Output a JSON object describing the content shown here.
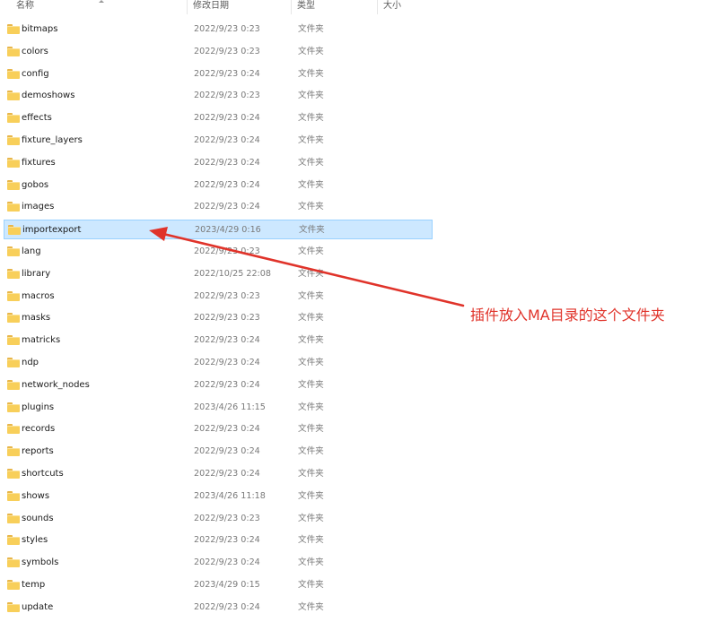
{
  "columns": {
    "name": "名称",
    "date": "修改日期",
    "type": "类型",
    "size": "大小"
  },
  "rows": [
    {
      "name": "bitmaps",
      "date": "2022/9/23 0:23",
      "type": "文件夹"
    },
    {
      "name": "colors",
      "date": "2022/9/23 0:23",
      "type": "文件夹"
    },
    {
      "name": "config",
      "date": "2022/9/23 0:24",
      "type": "文件夹"
    },
    {
      "name": "demoshows",
      "date": "2022/9/23 0:23",
      "type": "文件夹"
    },
    {
      "name": "effects",
      "date": "2022/9/23 0:24",
      "type": "文件夹"
    },
    {
      "name": "fixture_layers",
      "date": "2022/9/23 0:24",
      "type": "文件夹"
    },
    {
      "name": "fixtures",
      "date": "2022/9/23 0:24",
      "type": "文件夹"
    },
    {
      "name": "gobos",
      "date": "2022/9/23 0:24",
      "type": "文件夹"
    },
    {
      "name": "images",
      "date": "2022/9/23 0:24",
      "type": "文件夹"
    },
    {
      "name": "importexport",
      "date": "2023/4/29 0:16",
      "type": "文件夹",
      "selected": true
    },
    {
      "name": "lang",
      "date": "2022/9/23 0:23",
      "type": "文件夹"
    },
    {
      "name": "library",
      "date": "2022/10/25 22:08",
      "type": "文件夹"
    },
    {
      "name": "macros",
      "date": "2022/9/23 0:23",
      "type": "文件夹"
    },
    {
      "name": "masks",
      "date": "2022/9/23 0:23",
      "type": "文件夹"
    },
    {
      "name": "matricks",
      "date": "2022/9/23 0:24",
      "type": "文件夹"
    },
    {
      "name": "ndp",
      "date": "2022/9/23 0:24",
      "type": "文件夹"
    },
    {
      "name": "network_nodes",
      "date": "2022/9/23 0:24",
      "type": "文件夹"
    },
    {
      "name": "plugins",
      "date": "2023/4/26 11:15",
      "type": "文件夹"
    },
    {
      "name": "records",
      "date": "2022/9/23 0:24",
      "type": "文件夹"
    },
    {
      "name": "reports",
      "date": "2022/9/23 0:24",
      "type": "文件夹"
    },
    {
      "name": "shortcuts",
      "date": "2022/9/23 0:24",
      "type": "文件夹"
    },
    {
      "name": "shows",
      "date": "2023/4/26 11:18",
      "type": "文件夹"
    },
    {
      "name": "sounds",
      "date": "2022/9/23 0:23",
      "type": "文件夹"
    },
    {
      "name": "styles",
      "date": "2022/9/23 0:24",
      "type": "文件夹"
    },
    {
      "name": "symbols",
      "date": "2022/9/23 0:24",
      "type": "文件夹"
    },
    {
      "name": "temp",
      "date": "2023/4/29 0:15",
      "type": "文件夹"
    },
    {
      "name": "update",
      "date": "2022/9/23 0:24",
      "type": "文件夹"
    }
  ],
  "annotation": {
    "text": "插件放入MA目录的这个文件夹",
    "color": "#e0332a"
  },
  "icons": {
    "folder": "folder-icon",
    "sort": "sort-up-icon",
    "arrow": "arrow-icon"
  },
  "colors": {
    "selection": "#cde8ff",
    "selection_border": "#99d1ff",
    "folder": "#f8cf5a"
  }
}
